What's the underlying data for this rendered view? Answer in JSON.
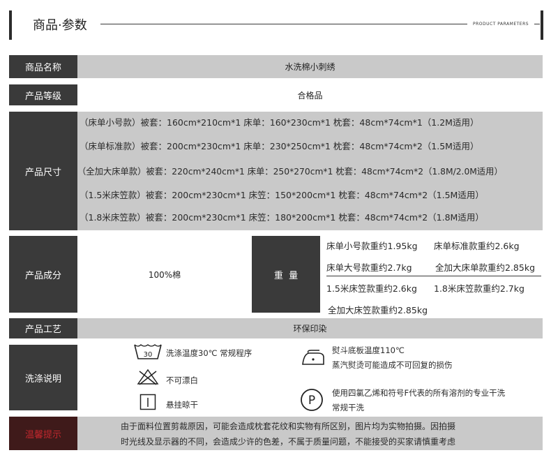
{
  "header": {
    "title": "商品·参数",
    "subtitle": "PRODUCT PARAMETERS"
  },
  "rows": {
    "name": {
      "label": "商品名称",
      "value": "水洗棉小刺绣"
    },
    "grade": {
      "label": "产品等级",
      "value": "合格品"
    },
    "size": {
      "label": "产品尺寸",
      "lines": [
        "（床单小号款）被套：160cm*210cm*1  床单：160*230cm*1  枕套：48cm*74cm*1（1.2M适用）",
        "（床单标准款）被套：200cm*230cm*1  床单：230*250cm*1  枕套：48cm*74cm*2（1.5M适用）",
        "（全加大床单款）被套：220cm*240cm*1  床单：250*270cm*1  枕套：48cm*74cm*2（1.8M/2.0M适用）",
        "（1.5米床笠款）被套：200cm*230cm*1  床笠：150*200cm*1  枕套：48cm*74cm*2（1.5M适用）",
        "（1.8米床笠款）被套：200cm*230cm*1  床笠：180*200cm*1  枕套：48cm*74cm*2（1.8M适用）"
      ]
    },
    "composition": {
      "label": "产品成分",
      "value": "100%棉",
      "weight_label": "重  量",
      "weights": [
        "床单小号款重约1.95kg",
        "床单标准款重约2.6kg",
        "床单大号款重约2.7kg",
        "全加大床单款重约2.85kg",
        "1.5米床笠款重约2.6kg",
        "1.8米床笠款重约2.7kg",
        "全加大床笠款重约2.85kg"
      ]
    },
    "craft": {
      "label": "产品工艺",
      "value": "环保印染"
    },
    "wash": {
      "label": "洗涤说明",
      "temp_badge": "30",
      "items": {
        "temp": "洗涤温度30℃  常规程序",
        "no_bleach": "不可漂白",
        "hang_dry": "悬挂晾干",
        "iron_line1": "熨斗底板温度110℃",
        "iron_line2": "蒸汽熨烫可能造成不可回复的损伤",
        "dryclean_badge": "P",
        "dryclean_line1": "使用四氯乙烯和符号F代表的所有溶剂的专业干洗",
        "dryclean_line2": "常规干洗"
      }
    },
    "tips": {
      "label": "温馨提示",
      "line1": "由于面料位置剪裁原因，可能会造成枕套花纹和实物有所区别，图片均为实物拍摄。因拍摄",
      "line2": "时光线及显示器的不同，会造成少许的色差，不属于质量问题，不能接受的买家请慎重考虑"
    }
  },
  "colors": {
    "label_bg": "#3a3a3a",
    "grey_bg": "#c9c9c9",
    "tips_label_bg": "#3f1a1a",
    "tips_text": "#c0272d"
  }
}
